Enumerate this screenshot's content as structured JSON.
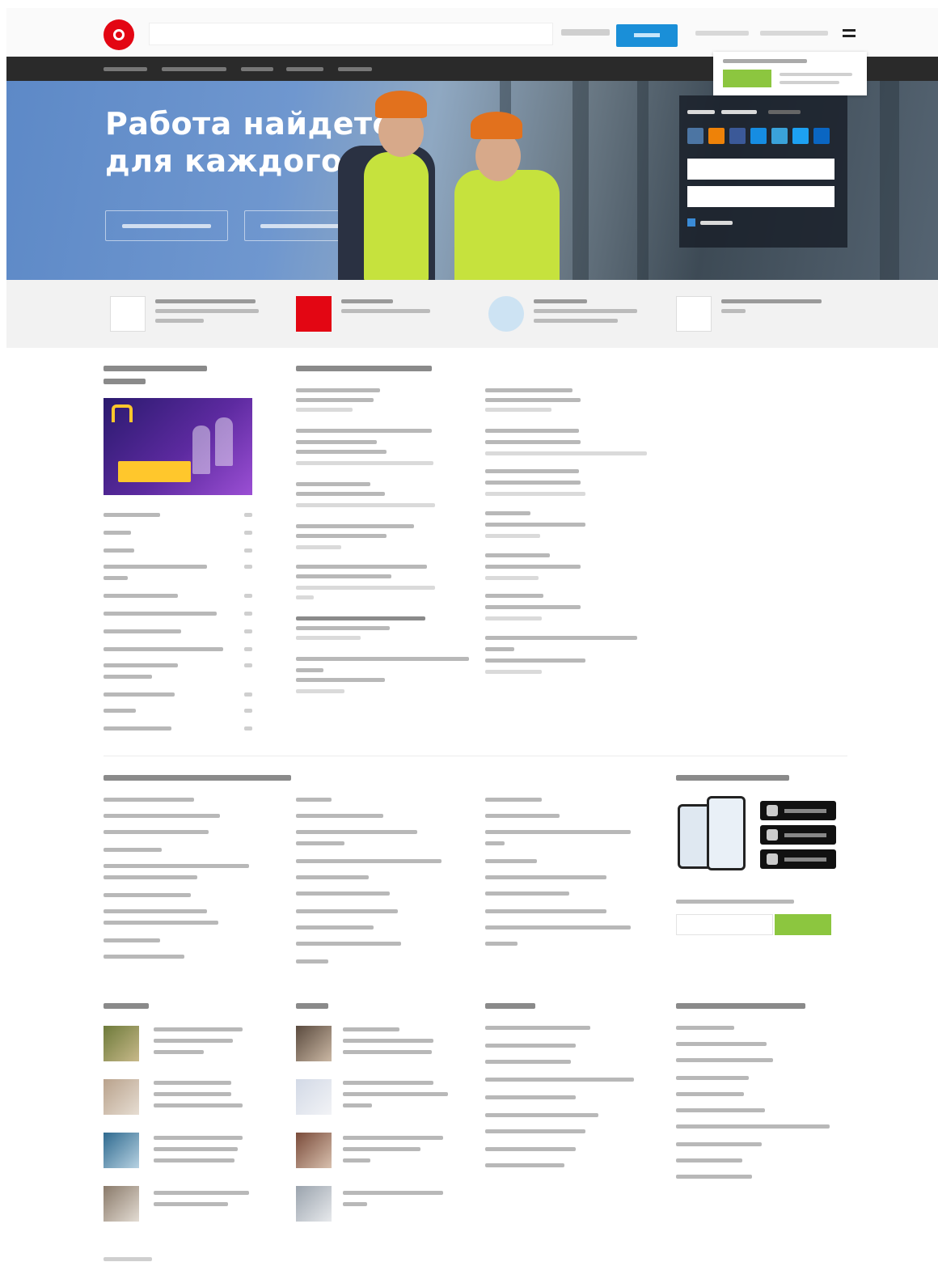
{
  "hero": {
    "title_line1": "Работа найдется",
    "title_line2": "для каждого"
  },
  "colors": {
    "brand_red": "#e30613",
    "accent_blue": "#1a8fd8",
    "accent_green": "#8cc63f",
    "nav_dark": "#2a2a2a"
  },
  "icons": {
    "logo": "hh-logo",
    "menu": "hamburger-icon",
    "social": [
      "vk-icon",
      "ok-icon",
      "fb-icon",
      "mailru-icon",
      "google-icon",
      "twitter-icon",
      "linkedin-icon"
    ]
  }
}
